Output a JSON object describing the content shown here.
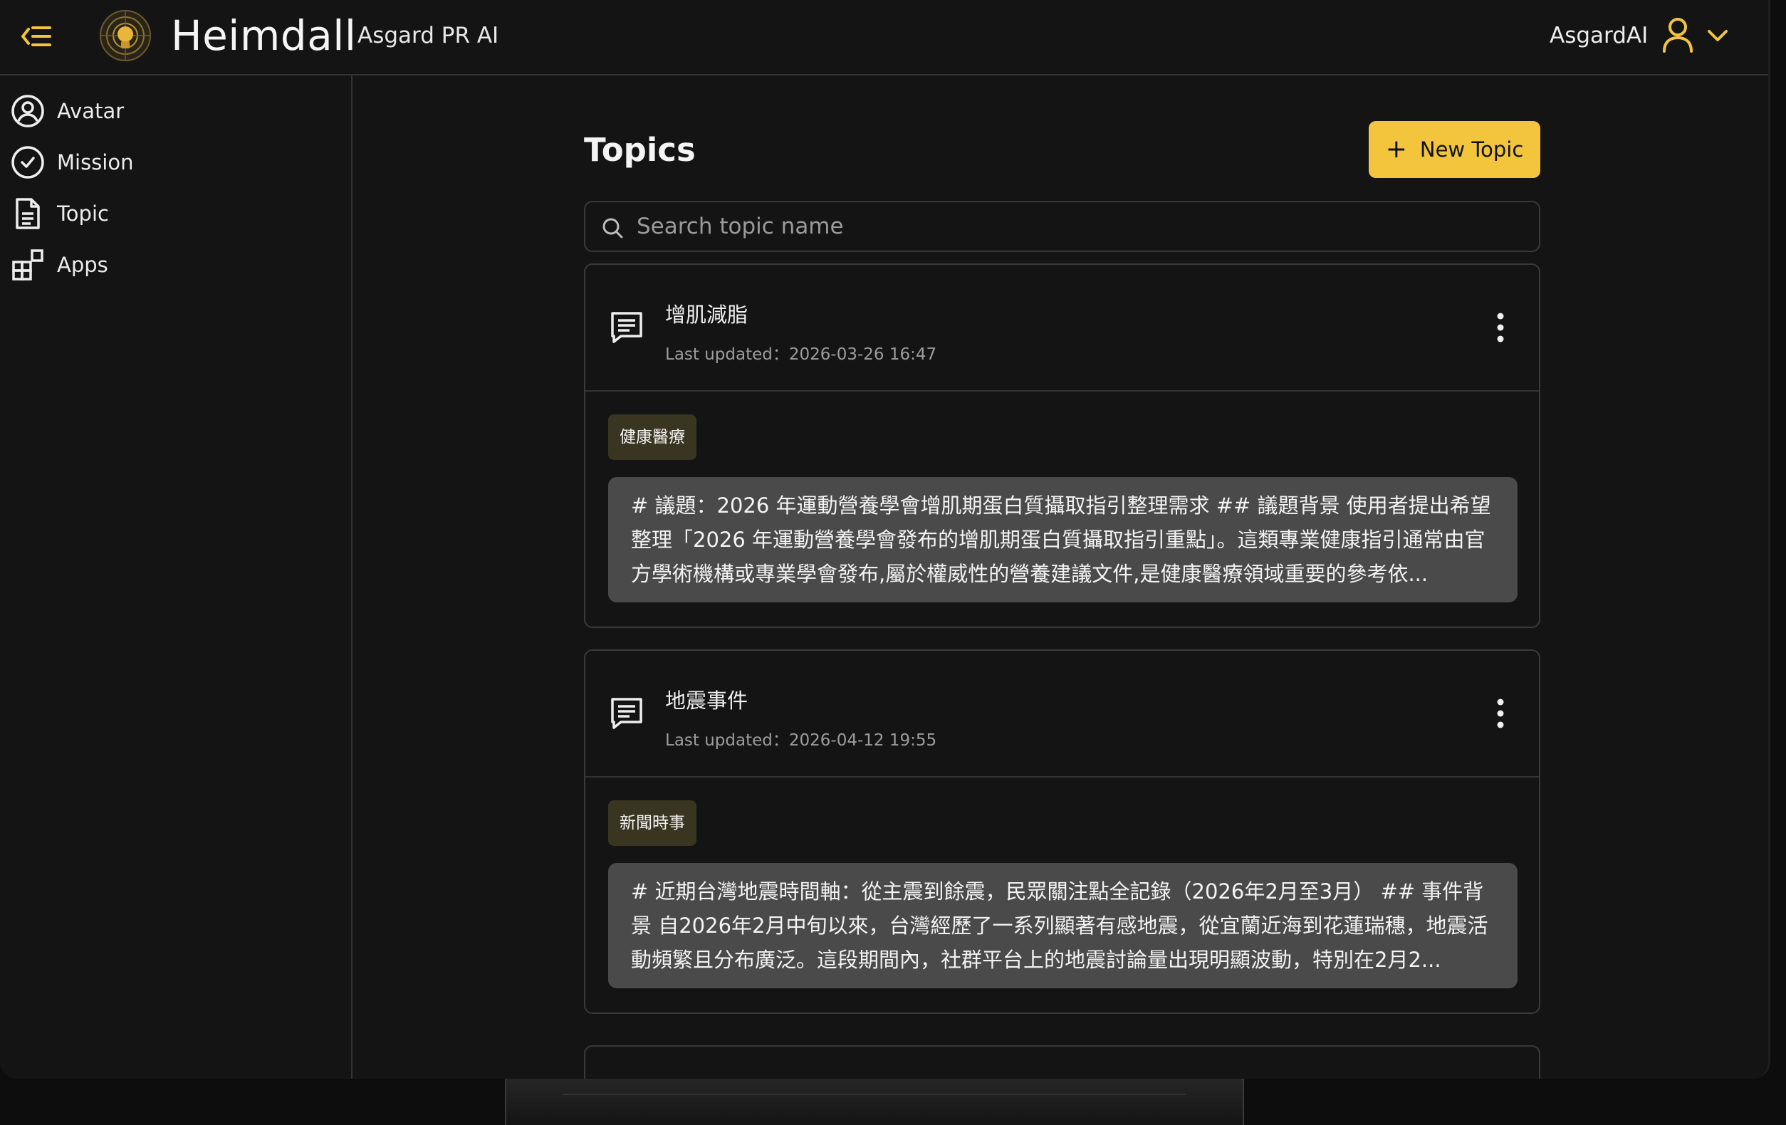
{
  "header": {
    "brand_name": "Heimdall",
    "brand_subtitle": "Asgard PR AI",
    "user_name": "AsgardAI"
  },
  "sidebar": {
    "items": [
      {
        "label": "Avatar",
        "icon": "avatar-icon"
      },
      {
        "label": "Mission",
        "icon": "check-circle-icon"
      },
      {
        "label": "Topic",
        "icon": "document-icon"
      },
      {
        "label": "Apps",
        "icon": "apps-grid-icon"
      }
    ]
  },
  "main": {
    "title": "Topics",
    "new_topic_label": "New Topic",
    "search_placeholder": "Search topic name",
    "topics": [
      {
        "title": "增肌減脂",
        "updated": "Last updated：2026-03-26 16:47",
        "tag": "健康醫療",
        "snippet": "# 議題：2026 年運動營養學會增肌期蛋白質攝取指引整理需求 ## 議題背景 使用者提出希望整理「2026 年運動營養學會發布的增肌期蛋白質攝取指引重點」。這類專業健康指引通常由官方學術機構或專業學會發布,屬於權威性的營養建議文件,是健康醫療領域重要的參考依..."
      },
      {
        "title": "地震事件",
        "updated": "Last updated：2026-04-12 19:55",
        "tag": "新聞時事",
        "snippet": "# 近期台灣地震時間軸：從主震到餘震，民眾關注點全記錄（2026年2月至3月） ## 事件背景 自2026年2月中旬以來，台灣經歷了一系列顯著有感地震，從宜蘭近海到花蓮瑞穗，地震活動頻繁且分布廣泛。這段期間內，社群平台上的地震討論量出現明顯波動，特別在2月2..."
      }
    ]
  },
  "colors": {
    "accent": "#f2c53d",
    "background": "#141414",
    "tag_background": "#3a3520",
    "snippet_background": "#4a4a4a"
  }
}
